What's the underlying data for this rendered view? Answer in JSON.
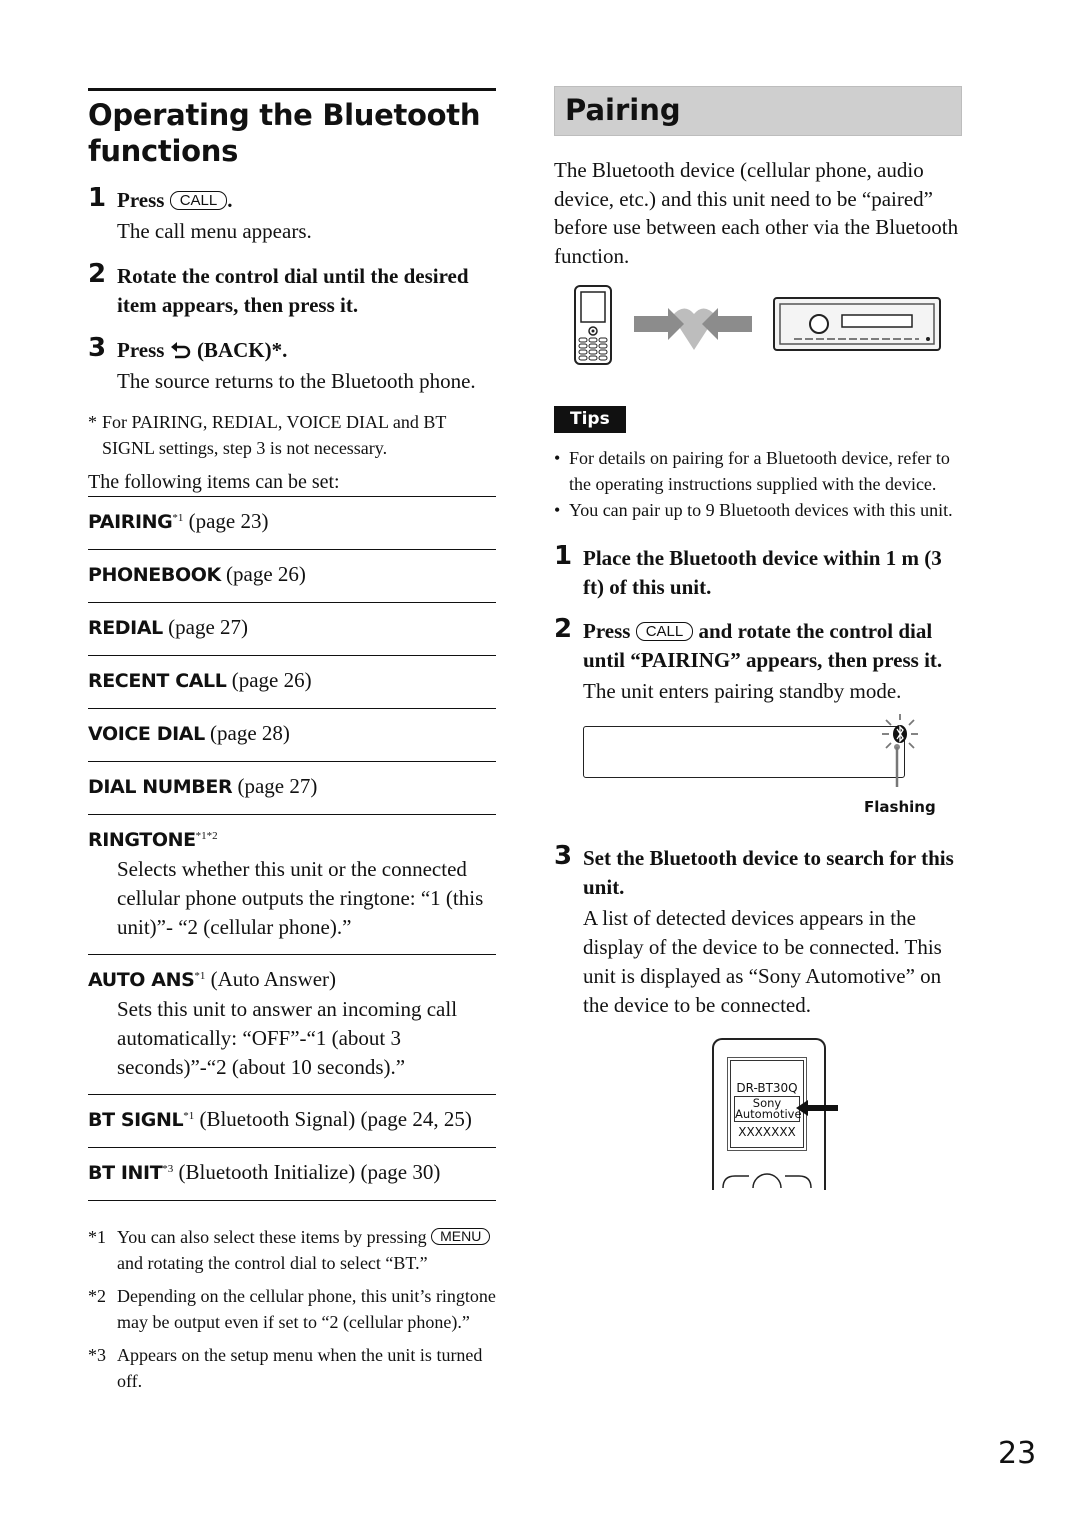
{
  "left": {
    "title": "Operating the Bluetooth functions",
    "steps": [
      {
        "num": "1",
        "title_pre": "Press ",
        "key": "CALL",
        "title_post": ".",
        "body": "The call menu appears."
      },
      {
        "num": "2",
        "title": "Rotate the control dial until the desired item appears, then press it."
      },
      {
        "num": "3",
        "title_pre": "Press ",
        "icon": "back-icon",
        "title_post": " (BACK)*.",
        "body": "The source returns to the Bluetooth phone."
      }
    ],
    "asterisk_note": {
      "mark": "*",
      "text": "For PAIRING, REDIAL, VOICE DIAL and BT SIGNL settings, step 3 is not necessary."
    },
    "intro": "The following items can be set:",
    "items": [
      {
        "name": "PAIRING",
        "sup": "*1",
        "text": " (page 23)"
      },
      {
        "name": "PHONEBOOK",
        "sup": "",
        "text": " (page 26)"
      },
      {
        "name": "REDIAL",
        "sup": "",
        "text": " (page 27)"
      },
      {
        "name": "RECENT CALL",
        "sup": "",
        "text": " (page 26)"
      },
      {
        "name": "VOICE DIAL",
        "sup": "",
        "text": " (page 28)"
      },
      {
        "name": "DIAL NUMBER",
        "sup": "",
        "text": " (page 27)"
      },
      {
        "name": "RINGTONE",
        "sup": "*1*2",
        "text": "",
        "desc": "Selects whether this unit or the connected cellular phone outputs the ringtone: “1 (this unit)”- “2 (cellular phone).”"
      },
      {
        "name": "AUTO ANS",
        "sup": "*1",
        "text": " (Auto Answer)",
        "desc": "Sets this unit to answer an incoming call automatically: “OFF”-“1 (about 3 seconds)”-“2 (about 10 seconds).”"
      },
      {
        "name": "BT SIGNL",
        "sup": "*1",
        "text": " (Bluetooth Signal) (page 24, 25)"
      },
      {
        "name": "BT INIT",
        "sup": "*3",
        "text": " (Bluetooth Initialize) (page 30)"
      }
    ],
    "footnotes": [
      {
        "mark": "*1",
        "pre": "You can also select these items by pressing ",
        "key": "MENU",
        "post": " and rotating the control dial to select “BT.”"
      },
      {
        "mark": "*2",
        "pre": "Depending on the cellular phone, this unit’s ringtone may be output even if set to “2 (cellular phone).”"
      },
      {
        "mark": "*3",
        "pre": "Appears on the setup menu when the unit is turned off."
      }
    ]
  },
  "right": {
    "title": "Pairing",
    "intro": "The Bluetooth device (cellular phone, audio device, etc.) and this unit need to be “paired” before use between each other via the Bluetooth function.",
    "tips_label": "Tips",
    "tips": [
      "For details on pairing for a Bluetooth device, refer to the operating instructions supplied with the device.",
      "You can pair up to 9 Bluetooth devices with this unit."
    ],
    "steps": [
      {
        "num": "1",
        "title": "Place the Bluetooth device within 1 m (3 ft) of this unit."
      },
      {
        "num": "2",
        "title_pre": "Press ",
        "key": "CALL",
        "title_post": " and rotate the control dial until “PAIRING” appears, then press it.",
        "body": "The unit enters pairing standby mode."
      },
      {
        "num": "3",
        "title": "Set the Bluetooth device to search for this unit.",
        "body": "A list of detected devices appears in the display of the device to be connected. This unit is displayed as “Sony Automotive” on the device to be connected."
      }
    ],
    "display_callout": "Flashing",
    "phone_screen": {
      "line1": "DR-BT30Q",
      "selected_line1": "Sony",
      "selected_line2": "Automotive",
      "line3": "XXXXXXX"
    }
  },
  "page_number": "23"
}
